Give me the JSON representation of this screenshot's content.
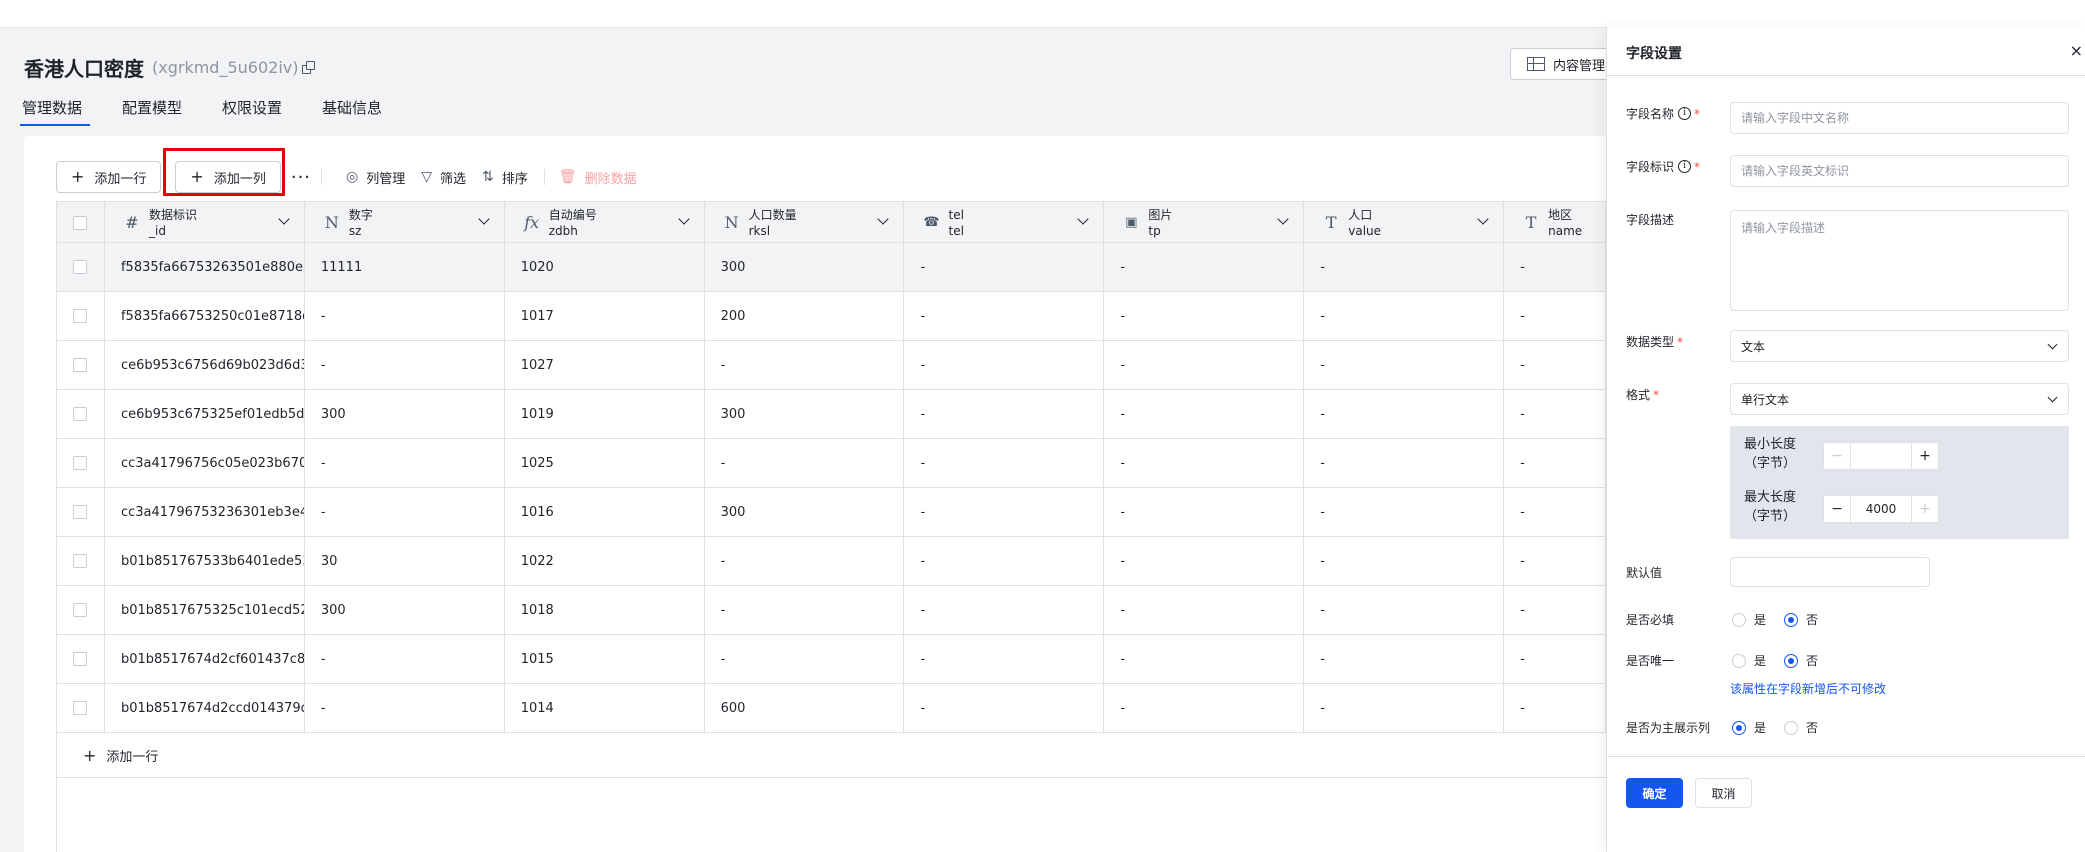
{
  "page": {
    "title": "香港人口密度",
    "identifier": "(xgrkmd_5u602iv)",
    "content_button": "内容管理"
  },
  "tabs": [
    "管理数据",
    "配置模型",
    "权限设置",
    "基础信息"
  ],
  "toolbar": {
    "add_row": "添加一行",
    "add_column": "添加一列",
    "more": "···",
    "column_manage": "列管理",
    "filter": "筛选",
    "sort": "排序",
    "delete": "删除数据"
  },
  "columns": [
    {
      "icon": "#",
      "name": "数据标识",
      "key": "_id"
    },
    {
      "icon": "N",
      "name": "数字",
      "key": "sz"
    },
    {
      "icon": "fx",
      "name": "自动编号",
      "key": "zdbh"
    },
    {
      "icon": "N",
      "name": "人口数量",
      "key": "rksl"
    },
    {
      "icon": "☎",
      "name": "tel",
      "key": "tel"
    },
    {
      "icon": "▣",
      "name": "图片",
      "key": "tp"
    },
    {
      "icon": "T",
      "name": "人口",
      "key": "value"
    },
    {
      "icon": "T",
      "name": "地区",
      "key": "name"
    }
  ],
  "rows": [
    [
      "f5835fa66753263501e880e8...",
      "11111",
      "1020",
      "300",
      "-",
      "-",
      "-",
      "-"
    ],
    [
      "f5835fa66753250c01e8718d...",
      "-",
      "1017",
      "200",
      "-",
      "-",
      "-",
      "-"
    ],
    [
      "ce6b953c6756d69b023d6d3...",
      "-",
      "1027",
      "-",
      "-",
      "-",
      "-",
      "-"
    ],
    [
      "ce6b953c675325ef01edb5d...",
      "300",
      "1019",
      "300",
      "-",
      "-",
      "-",
      "-"
    ],
    [
      "cc3a41796756c05e023b670...",
      "-",
      "1025",
      "-",
      "-",
      "-",
      "-",
      "-"
    ],
    [
      "cc3a41796753236301eb3e4...",
      "-",
      "1016",
      "300",
      "-",
      "-",
      "-",
      "-"
    ],
    [
      "b01b851767533b6401ede53...",
      "30",
      "1022",
      "-",
      "-",
      "-",
      "-",
      "-"
    ],
    [
      "b01b8517675325c101ecd52...",
      "300",
      "1018",
      "-",
      "-",
      "-",
      "-",
      "-"
    ],
    [
      "b01b8517674d2cf601437c8...",
      "-",
      "1015",
      "-",
      "-",
      "-",
      "-",
      "-"
    ],
    [
      "b01b8517674d2ccd014379d...",
      "-",
      "1014",
      "600",
      "-",
      "-",
      "-",
      "-"
    ]
  ],
  "table_footer": {
    "add_row": "添加一行"
  },
  "drawer": {
    "title": "字段设置",
    "close": "×",
    "field_name_label": "字段名称",
    "field_name_placeholder": "请输入字段中文名称",
    "field_key_label": "字段标识",
    "field_key_placeholder": "请输入字段英文标识",
    "desc_label": "字段描述",
    "desc_placeholder": "请输入字段描述",
    "data_type_label": "数据类型",
    "data_type_value": "文本",
    "format_label": "格式",
    "format_value": "单行文本",
    "min_len_label": "最小长度（字节）",
    "min_len_value": "",
    "max_len_label": "最大长度（字节）",
    "max_len_value": "4000",
    "default_label": "默认值",
    "required_label": "是否必填",
    "unique_label": "是否唯一",
    "unique_note": "该属性在字段新增后不可修改",
    "primary_label": "是否为主展示列",
    "yes": "是",
    "no": "否",
    "required_selected": "否",
    "unique_selected": "否",
    "primary_selected": "是",
    "confirm": "确定",
    "cancel": "取消"
  },
  "colors": {
    "primary": "#1456f0",
    "highlight": "#e8000b",
    "danger_disabled": "#f7a3a3"
  }
}
